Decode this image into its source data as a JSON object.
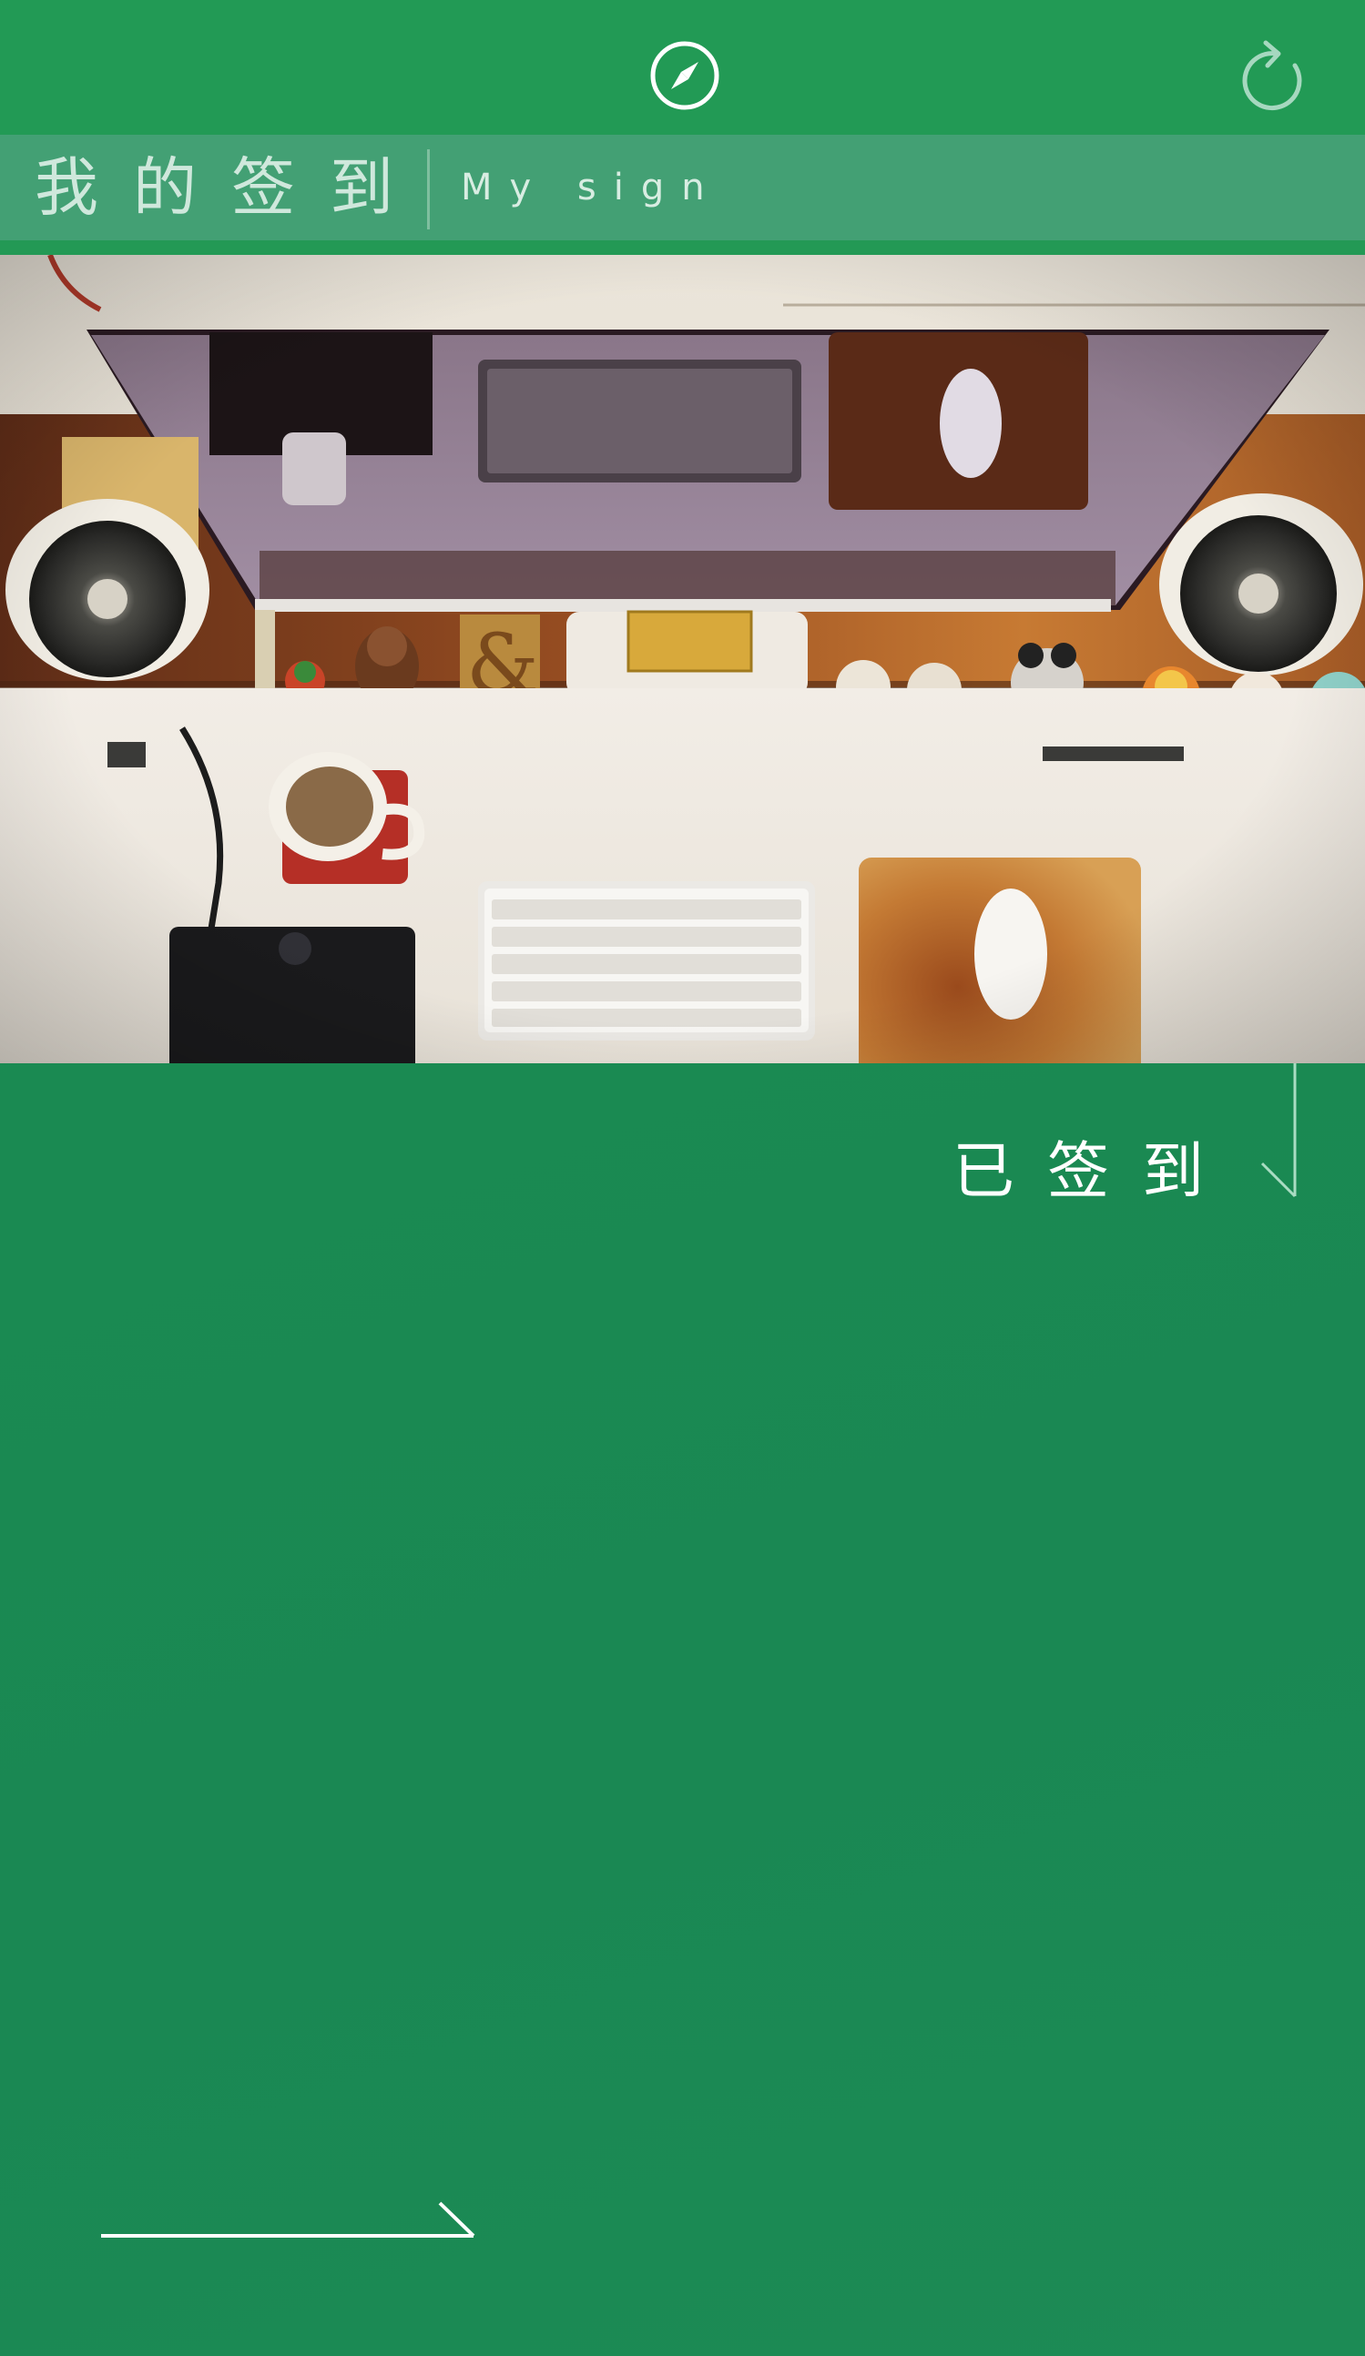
{
  "header": {
    "compass_icon": "compass-icon",
    "refresh_icon": "refresh-icon"
  },
  "title": {
    "cn": "我的签到",
    "en": "My sign"
  },
  "hero": {
    "image": "desk-workspace-photo"
  },
  "status": {
    "label": "已签到",
    "icon": "down-arrow-icon"
  },
  "footer": {
    "next_icon": "right-arrow-icon"
  },
  "colors": {
    "primary_green": "#229a55",
    "title_band": "#43a074",
    "background": "#1a8a52",
    "text_white": "#ffffff"
  }
}
